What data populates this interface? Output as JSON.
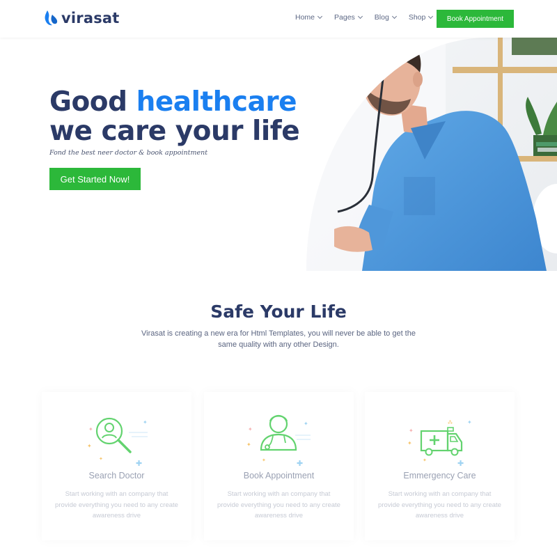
{
  "header": {
    "logo_text": "virasat",
    "nav": [
      {
        "label": "Home"
      },
      {
        "label": "Pages"
      },
      {
        "label": "Blog"
      },
      {
        "label": "Shop"
      }
    ],
    "book_button": "Book Appointment"
  },
  "hero": {
    "title_part1": "Good ",
    "title_accent": "healthcare",
    "title_line2": "we care your life",
    "subtitle": "Fond the best neer doctor & book appointment",
    "cta": "Get Started Now!"
  },
  "section": {
    "title": "Safe Your Life",
    "description": "Virasat is creating a new era for Html Templates, you will never be able to get the same quality with any other Design."
  },
  "cards": [
    {
      "icon": "search-doctor-icon",
      "title": "Search Doctor",
      "description": "Start working with an company that provide everything you need to any create awareness drive"
    },
    {
      "icon": "doctor-icon",
      "title": "Book Appointment",
      "description": "Start working with an company that provide everything you need to any create awareness drive"
    },
    {
      "icon": "ambulance-icon",
      "title": "Emmergency Care",
      "description": "Start working with an company that provide everything you need to any create awareness drive"
    }
  ],
  "colors": {
    "primary_text": "#2b3a67",
    "accent_blue": "#1a7ff0",
    "button_green": "#2cb83a",
    "icon_green": "#63d36f"
  }
}
